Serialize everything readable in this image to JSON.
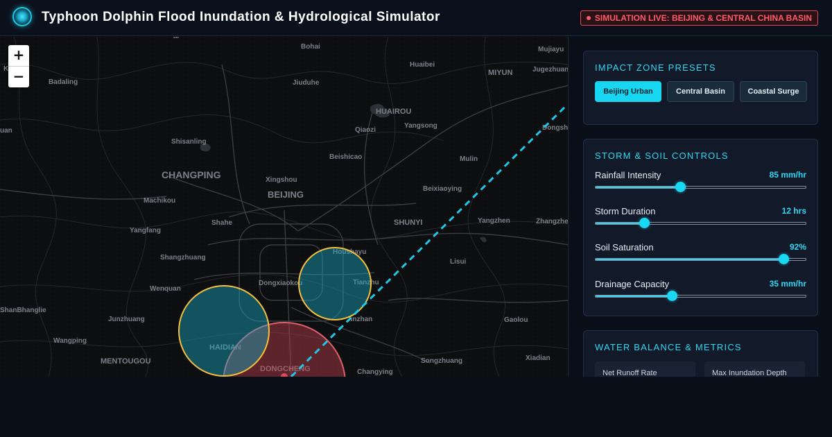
{
  "header": {
    "title": "Typhoon Dolphin Flood Inundation & Hydrological Simulator",
    "live_status": "SIMULATION LIVE: BEIJING & CENTRAL CHINA BASIN",
    "logo_icon": "radar-logo-icon"
  },
  "map": {
    "zoom_in_label": "+",
    "zoom_out_label": "−",
    "labels": [
      {
        "id": "bohai",
        "text": "Bohai"
      },
      {
        "id": "mujiayu",
        "text": "Mujiayu"
      },
      {
        "id": "huaibei",
        "text": "Huaibei"
      },
      {
        "id": "miyun",
        "text": "MIYUN"
      },
      {
        "id": "jugezhuang",
        "text": "Jugezhuan"
      },
      {
        "id": "kuang",
        "text": "Kuang"
      },
      {
        "id": "badaling",
        "text": "Badaling"
      },
      {
        "id": "jiuduhe",
        "text": "Jiuduhe"
      },
      {
        "id": "huairou",
        "text": "HUAIROU"
      },
      {
        "id": "qiaozi",
        "text": "Qiaozi"
      },
      {
        "id": "yangsong",
        "text": "Yangsong"
      },
      {
        "id": "uan",
        "text": "uan"
      },
      {
        "id": "dongsha",
        "text": "Dongsha"
      },
      {
        "id": "shisanling",
        "text": "Shisanling"
      },
      {
        "id": "beishicao",
        "text": "Beishicao"
      },
      {
        "id": "mulin",
        "text": "Mulin"
      },
      {
        "id": "changping",
        "text": "CHANGPING"
      },
      {
        "id": "xingshou",
        "text": "Xingshou"
      },
      {
        "id": "beijing",
        "text": "BEIJING"
      },
      {
        "id": "beixiaoying",
        "text": "Beixiaoying"
      },
      {
        "id": "machikou",
        "text": "Machikou"
      },
      {
        "id": "shahe",
        "text": "Shahe"
      },
      {
        "id": "shunyi",
        "text": "SHUNYI"
      },
      {
        "id": "yangzhen",
        "text": "Yangzhen"
      },
      {
        "id": "zhangzhen",
        "text": "Zhangzhe"
      },
      {
        "id": "yangfang",
        "text": "Yangfang"
      },
      {
        "id": "houshayu",
        "text": "Houshayu"
      },
      {
        "id": "shangzhuang",
        "text": "Shangzhuang"
      },
      {
        "id": "lisui",
        "text": "Lisui"
      },
      {
        "id": "wenquan",
        "text": "Wenquan"
      },
      {
        "id": "dongxiaokou",
        "text": "Dongxiaokou"
      },
      {
        "id": "tianzhu",
        "text": "Tianzhu"
      },
      {
        "id": "junzhuang",
        "text": "Junzhuang"
      },
      {
        "id": "jinzhan",
        "text": "Jinzhan"
      },
      {
        "id": "gaolou",
        "text": "Gaolou"
      },
      {
        "id": "wangping",
        "text": "Wangping"
      },
      {
        "id": "haidian",
        "text": "HAIDIAN"
      },
      {
        "id": "mentougou",
        "text": "MENTOUGOU"
      },
      {
        "id": "dongcheng",
        "text": "DONGCHENG"
      },
      {
        "id": "changying",
        "text": "Changying"
      },
      {
        "id": "songzhuang",
        "text": "Songzhuang"
      },
      {
        "id": "xiadian",
        "text": "Xiadian"
      },
      {
        "id": "shaoshan",
        "text": "ShanBhanglie"
      },
      {
        "id": "al",
        "text": "al"
      }
    ]
  },
  "presets": {
    "title": "IMPACT ZONE PRESETS",
    "items": [
      {
        "label": "Beijing Urban",
        "active": true
      },
      {
        "label": "Central Basin",
        "active": false
      },
      {
        "label": "Coastal Surge",
        "active": false
      }
    ]
  },
  "controls": {
    "title": "STORM & SOIL CONTROLS",
    "sliders": [
      {
        "label": "Rainfall Intensity",
        "value_text": "85 mm/hr",
        "fraction": 0.4
      },
      {
        "label": "Storm Duration",
        "value_text": "12 hrs",
        "fraction": 0.23
      },
      {
        "label": "Soil Saturation",
        "value_text": "92%",
        "fraction": 0.89
      },
      {
        "label": "Drainage Capacity",
        "value_text": "35 mm/hr",
        "fraction": 0.36
      }
    ]
  },
  "metrics": {
    "title": "WATER BALANCE & METRICS",
    "cards": [
      {
        "label": "Net Runoff Rate"
      },
      {
        "label": "Max Inundation Depth"
      }
    ]
  },
  "colors": {
    "accent": "#2ed8f2",
    "live_red": "#ff5b6a",
    "flood_zone_fill": "#1aa7c0",
    "flood_zone_stroke": "#f5c13a",
    "surge_zone_fill": "#c2414d",
    "track_line": "#1ec9e8"
  }
}
